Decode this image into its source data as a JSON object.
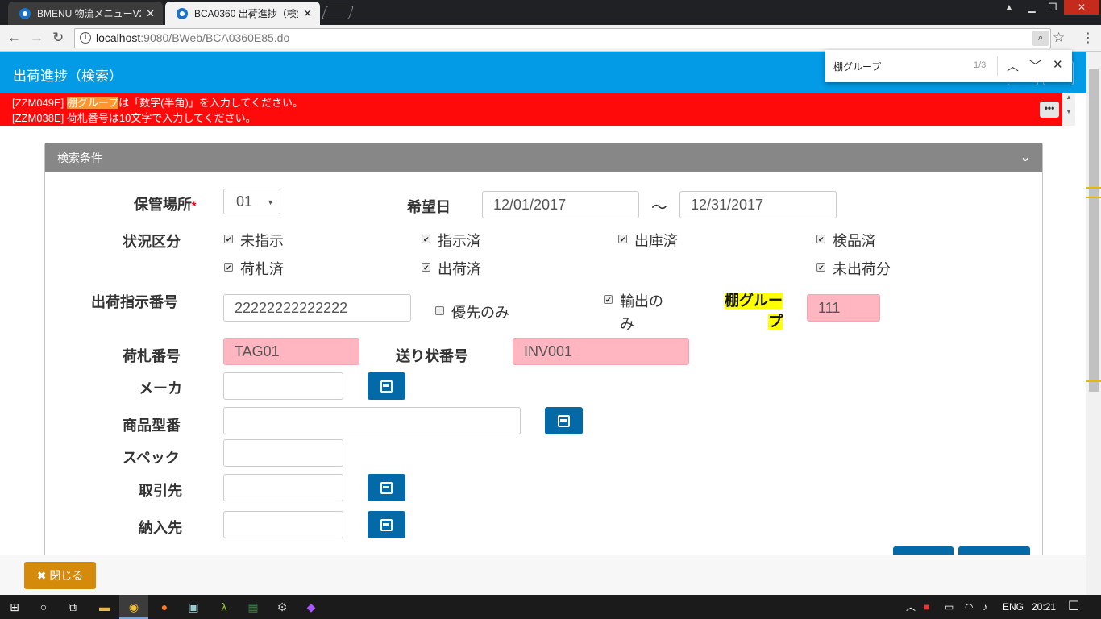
{
  "browser": {
    "tabs": [
      {
        "title": "BMENU 物流メニューV2",
        "active": false
      },
      {
        "title": "BCA0360 出荷進捗（検索",
        "active": true
      }
    ],
    "url_host": "localhost",
    "url_path": ":9080/BWeb/BCA0360E85.do",
    "find": {
      "query": "棚グループ",
      "count": "1/3"
    }
  },
  "header": {
    "title": "出荷進捗（検索）"
  },
  "errors": {
    "line1_code": "[ZZM049E]",
    "line1_highlight": "棚グループ",
    "line1_rest": "は「数字(半角)」を入力してください。",
    "line2": "[ZZM038E] 荷札番号は10文字で入力してください。",
    "more": "•••"
  },
  "panel": {
    "title": "検索条件"
  },
  "form": {
    "storage_label": "保管場所",
    "required_mark": "*",
    "storage_value": "01",
    "date_label": "希望日",
    "date_from": "12/01/2017",
    "tilde": "～",
    "date_to": "12/31/2017",
    "status_label": "状況区分",
    "status_options": [
      {
        "label": "未指示",
        "checked": true
      },
      {
        "label": "指示済",
        "checked": true
      },
      {
        "label": "出庫済",
        "checked": true
      },
      {
        "label": "検品済",
        "checked": true
      },
      {
        "label": "荷札済",
        "checked": true
      },
      {
        "label": "出荷済",
        "checked": true
      },
      {
        "label": "未出荷分",
        "checked": true
      }
    ],
    "instruction_label": "出荷指示番号",
    "instruction_value": "22222222222222",
    "priority_label": "優先のみ",
    "priority_checked": false,
    "export_label_1": "輸出の",
    "export_label_2": "み",
    "export_checked": true,
    "shelf_label_1": "棚グルー",
    "shelf_label_2": "プ",
    "shelf_value": "111",
    "tag_label": "荷札番号",
    "tag_value": "TAG01",
    "invoice_label": "送り状番号",
    "invoice_value": "INV001",
    "maker_label": "メーカ",
    "model_label": "商品型番",
    "spec_label": "スペック",
    "client_label": "取引先",
    "delivery_label": "納入先"
  },
  "footer": {
    "close_label": "閉じる",
    "close_icon": "✖"
  },
  "taskbar": {
    "lang": "ENG",
    "time": "20:21"
  },
  "colors": {
    "header": "#039be5",
    "error": "#ff0a0a",
    "button": "#036aa7",
    "close": "#d58a0b"
  }
}
